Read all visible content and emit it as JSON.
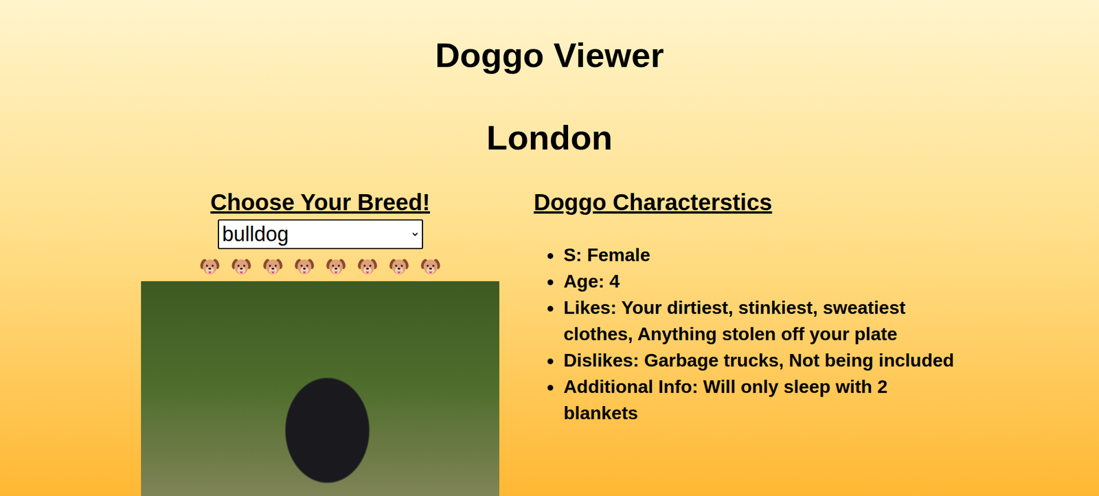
{
  "header": {
    "title": "Doggo Viewer",
    "city": "London"
  },
  "breed_panel": {
    "heading": "Choose Your Breed!",
    "select": {
      "value": "bulldog"
    }
  },
  "characteristics": {
    "heading": "Doggo Characterstics",
    "items": [
      "S: Female",
      "Age: 4",
      "Likes: Your dirtiest, stinkiest, sweatiest clothes, Anything stolen off your plate",
      "Dislikes: Garbage trucks, Not being included",
      "Additional Info: Will only sleep with 2 blankets"
    ]
  }
}
